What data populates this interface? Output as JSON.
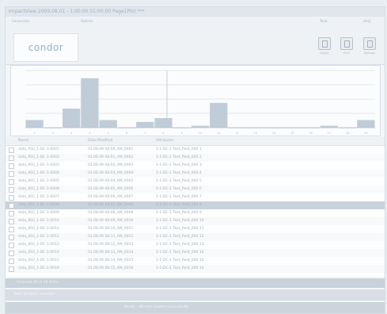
{
  "window": {
    "title": "ImpactView 2009.08.01 - 1:00:00 01:00:00 Page1Plot ***"
  },
  "toolbar": {
    "group_left_label": "Connection",
    "group_mid_label": "Options",
    "group_right1_label": "Tools",
    "group_right2_label": "Help",
    "logo_text": "condor",
    "logo_tagline": " ",
    "buttons": [
      {
        "icon": "document-icon",
        "label": "Export"
      },
      {
        "icon": "document-icon",
        "label": "Print"
      },
      {
        "icon": "document-icon",
        "label": "Settings"
      }
    ]
  },
  "chart_data": {
    "type": "bar",
    "categories": [
      "1",
      "2",
      "3",
      "4",
      "5",
      "6",
      "7",
      "8",
      "9",
      "10",
      "11",
      "12",
      "13",
      "14",
      "15",
      "16",
      "17",
      "18",
      "19"
    ],
    "values": [
      4,
      0,
      10,
      26,
      4,
      0,
      3,
      5,
      0,
      1,
      13,
      0,
      0,
      0,
      0,
      0,
      1,
      0,
      4
    ],
    "ylim": [
      0,
      30
    ],
    "grid": true
  },
  "table": {
    "columns": [
      "Name",
      "Date Modified",
      "Attributes"
    ],
    "rows": [
      [
        "data_002_1-DC-1-0001",
        "01.08.09 08:00_AM_0001",
        "1-1-DC-1 Text_field_000 1"
      ],
      [
        "data_002_1-DC-1-0002",
        "01.08.09 08:01_AM_0002",
        "1-1-DC-1 Text_field_000 2"
      ],
      [
        "data_002_1-DC-1-0003",
        "01.08.09 08:02_AM_0003",
        "1-1-DC-1 Text_field_000 3"
      ],
      [
        "data_002_1-DC-1-0004",
        "01.08.09 08:03_AM_0004",
        "1-1-DC-1 Text_field_000 4"
      ],
      [
        "data_002_1-DC-1-0005",
        "01.08.09 08:04_AM_0005",
        "1-1-DC-1 Text_field_000 5"
      ],
      [
        "data_002_1-DC-1-0006",
        "01.08.09 08:05_AM_0006",
        "1-1-DC-1 Text_field_000 6"
      ],
      [
        "data_002_1-DC-1-0007",
        "01.08.09 08:06_AM_0007",
        "1-1-DC-1 Text_field_000 7"
      ],
      [
        "data_002_1-DC-1-0008",
        "01.08.09 08:07_AM_0008",
        "1-1-DC-1 Text_field_000 8"
      ],
      [
        "data_002_1-DC-1-0009",
        "01.08.09 08:08_AM_0009",
        "1-1-DC-1 Text_field_000 9"
      ],
      [
        "data_002_1-DC-1-0010",
        "01.08.09 08:09_AM_0010",
        "1-1-DC-1 Text_field_000 10"
      ],
      [
        "data_002_1-DC-1-0011",
        "01.08.09 08:10_AM_0011",
        "1-1-DC-1 Text_field_000 11"
      ],
      [
        "data_002_1-DC-1-0012",
        "01.08.09 08:11_AM_0012",
        "1-1-DC-1 Text_field_000 12"
      ],
      [
        "data_002_1-DC-1-0013",
        "01.08.09 08:12_AM_0013",
        "1-1-DC-1 Text_field_000 13"
      ],
      [
        "data_002_1-DC-1-0014",
        "01.08.09 08:13_AM_0014",
        "1-1-DC-1 Text_field_000 14"
      ],
      [
        "data_002_1-DC-1-0015",
        "01.08.09 08:14_AM_0015",
        "1-1-DC-1 Text_field_000 15"
      ],
      [
        "data_002_1-DC-1-0016",
        "01.08.09 08:15_AM_0016",
        "1-1-DC-1 Text_field_000 16"
      ]
    ],
    "selected_index": 7
  },
  "band1": {
    "left": "Selected 16 of 16 items",
    "right": " "
  },
  "band2": {
    "left": "Total 16 items selected",
    "right": " "
  },
  "statusbar": {
    "center": "Ready  -  All data loaded successfully",
    "right": " "
  },
  "colors": {
    "bar": "#c0ccd8",
    "grid": "#c9d3dc"
  }
}
